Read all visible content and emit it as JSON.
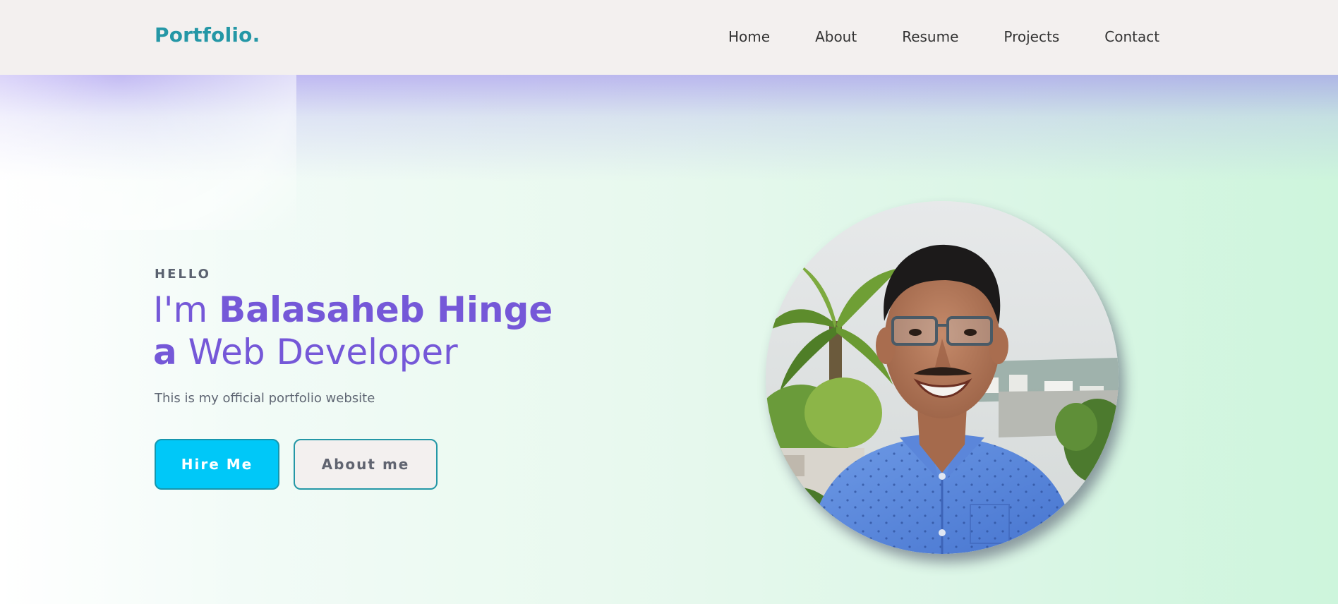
{
  "brand": "Portfolio.",
  "nav": {
    "items": [
      {
        "label": "Home"
      },
      {
        "label": "About"
      },
      {
        "label": "Resume"
      },
      {
        "label": "Projects"
      },
      {
        "label": "Contact"
      }
    ]
  },
  "hero": {
    "greeting": "HELLO",
    "headline_prefix": "I'm ",
    "name": "Balasaheb Hinge",
    "headline_article": "a",
    "role": " Web Developer",
    "tagline": "This is my official portfolio website",
    "primary_button": "Hire Me",
    "secondary_button": "About me"
  },
  "colors": {
    "brand": "#2497a6",
    "headline": "#7558d8",
    "primary_button": "#00c8f8",
    "navbar_bg": "#f3f0ef"
  }
}
